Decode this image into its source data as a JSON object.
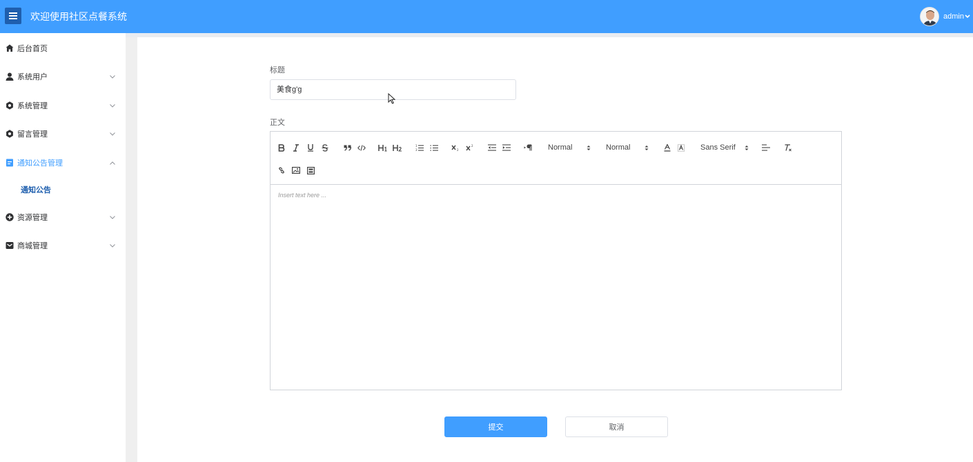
{
  "header": {
    "title": "欢迎使用社区点餐系统",
    "username": "admin",
    "bg_color": "#409eff"
  },
  "sidebar": {
    "items": [
      {
        "label": "后台首页",
        "icon": "home-icon"
      },
      {
        "label": "系统用户",
        "icon": "user-icon"
      },
      {
        "label": "系统管理",
        "icon": "gear-icon"
      },
      {
        "label": "留言管理",
        "icon": "gear-icon"
      },
      {
        "label": "通知公告管理",
        "icon": "document-icon",
        "active": true
      },
      {
        "label": "资源管理",
        "icon": "plus-circle-icon"
      },
      {
        "label": "商城管理",
        "icon": "mail-icon"
      }
    ],
    "subitems": [
      {
        "label": "通知公告"
      }
    ]
  },
  "form": {
    "title_label": "标题",
    "title_value": "美食g'g",
    "body_label": "正文",
    "editor": {
      "header_select_value": "Normal",
      "size_select_value": "Normal",
      "font_select_value": "Sans Serif",
      "placeholder": "Insert text here ..."
    },
    "submit_label": "提交",
    "cancel_label": "取消"
  }
}
